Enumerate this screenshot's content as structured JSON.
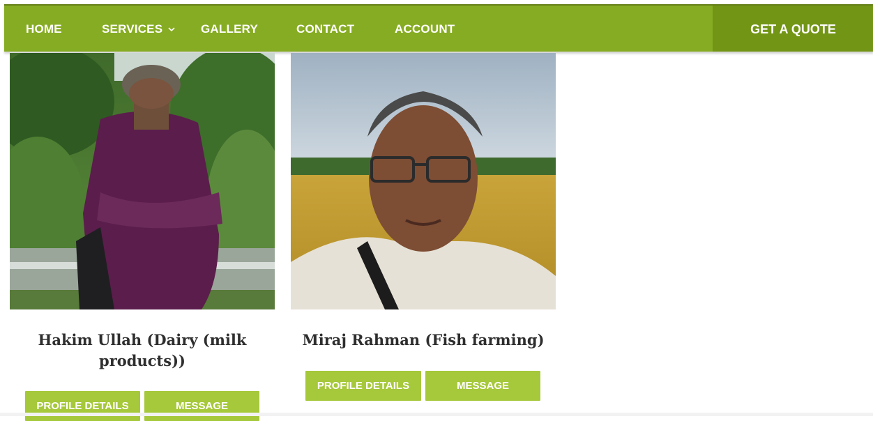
{
  "nav": {
    "items": [
      {
        "label": "HOME"
      },
      {
        "label": "SERVICES"
      },
      {
        "label": "GALLERY"
      },
      {
        "label": "CONTACT"
      },
      {
        "label": "ACCOUNT"
      }
    ],
    "services_icon": "chevron-down-icon",
    "quote_label": "GET A QUOTE"
  },
  "colors": {
    "nav_bg": "#86ac23",
    "quote_bg": "#729515",
    "button_bg": "#a6c83b",
    "name_text": "#2e2e2e"
  },
  "profiles": [
    {
      "name": "Hakim Ullah (Dairy (milk products))",
      "name_line1": "Hakim Ullah (Dairy (milk",
      "name_line2": "products))",
      "profile_button": "PROFILE DETAILS",
      "message_button": "MESSAGE"
    },
    {
      "name": "Miraj Rahman (Fish farming)",
      "profile_button": "PROFILE DETAILS",
      "message_button": "MESSAGE"
    }
  ]
}
